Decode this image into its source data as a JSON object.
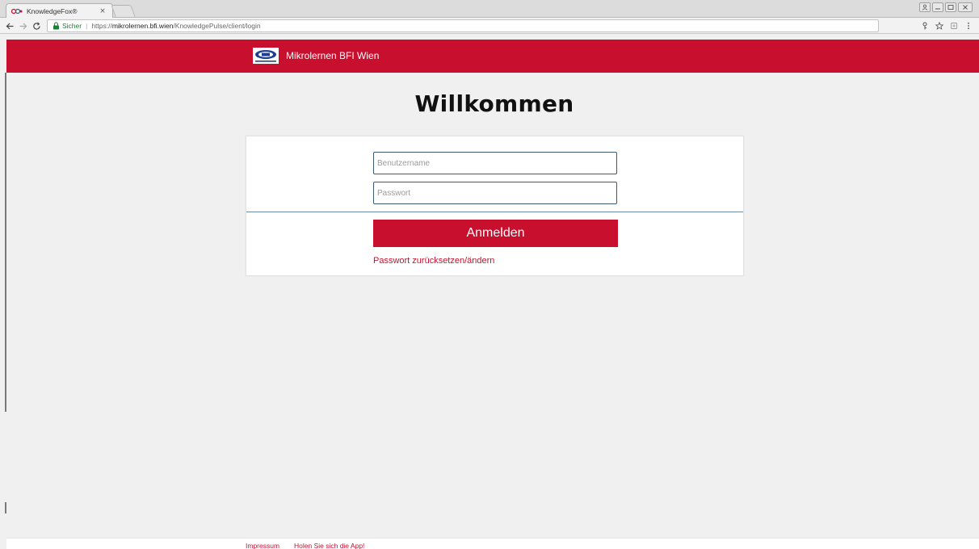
{
  "browser": {
    "tab": {
      "title": "KnowledgeFox®",
      "close": "×"
    },
    "address_bar": {
      "secure_label": "Sicher",
      "separator": "|",
      "url_prefix": "https://",
      "url_host": "mikrolernen.bfi.wien",
      "url_path": "/KnowledgePulse/client/login"
    }
  },
  "header": {
    "brand_name": "Mikrolernen BFI Wien"
  },
  "main": {
    "title": "Willkommen",
    "username_placeholder": "Benutzername",
    "password_placeholder": "Passwort",
    "login_label": "Anmelden",
    "reset_link": "Passwort zurücksetzen/ändern"
  },
  "footer": {
    "impressum": "Impressum",
    "get_app": "Holen Sie sich die App!"
  },
  "colors": {
    "brand": "#c8102e",
    "input_border": "#3c5a78",
    "background": "#f0f0f0"
  }
}
